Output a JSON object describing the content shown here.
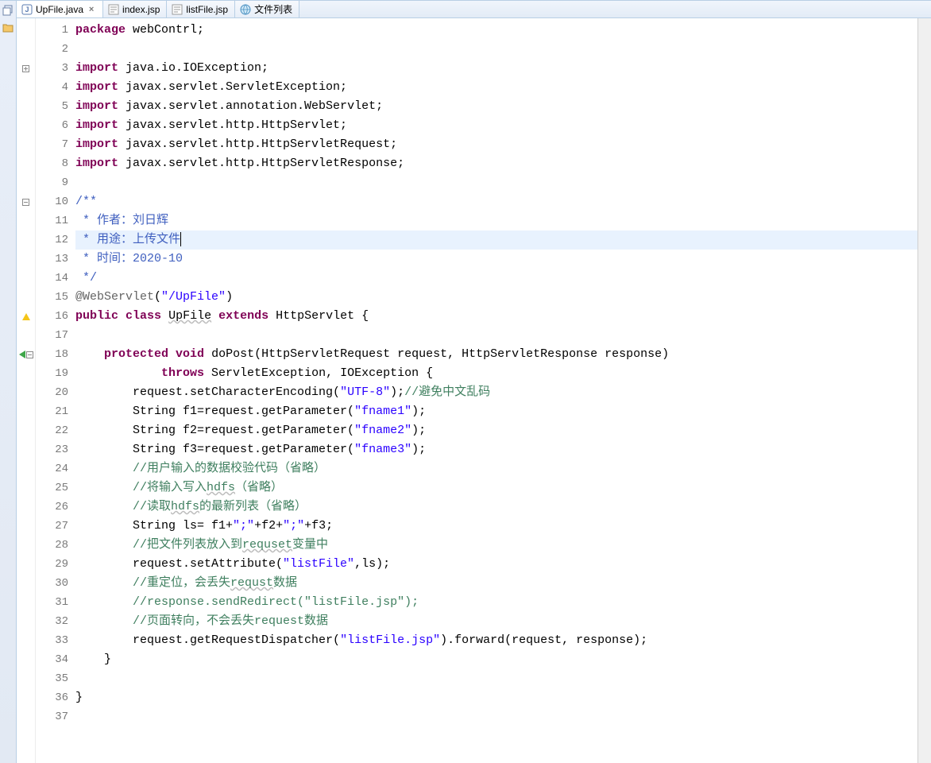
{
  "tabs": [
    {
      "label": "UpFile.java",
      "icon": "java-file-icon",
      "active": true,
      "closeable": true
    },
    {
      "label": "index.jsp",
      "icon": "jsp-file-icon",
      "active": false,
      "closeable": false
    },
    {
      "label": "listFile.jsp",
      "icon": "jsp-file-icon",
      "active": false,
      "closeable": false
    },
    {
      "label": "文件列表",
      "icon": "globe-icon",
      "active": false,
      "closeable": false
    }
  ],
  "left_tools": [
    "restore-icon",
    "folder-icon"
  ],
  "code": {
    "lines": [
      {
        "n": 1,
        "tokens": [
          [
            "kw",
            "package"
          ],
          [
            "",
            " webContrl;"
          ]
        ]
      },
      {
        "n": 2,
        "tokens": []
      },
      {
        "n": 3,
        "marker": "fold-plus",
        "tokens": [
          [
            "kw",
            "import"
          ],
          [
            "",
            " java.io.IOException;"
          ]
        ]
      },
      {
        "n": 4,
        "tokens": [
          [
            "kw",
            "import"
          ],
          [
            "",
            " javax.servlet.ServletException;"
          ]
        ]
      },
      {
        "n": 5,
        "tokens": [
          [
            "kw",
            "import"
          ],
          [
            "",
            " javax.servlet.annotation.WebServlet;"
          ]
        ]
      },
      {
        "n": 6,
        "tokens": [
          [
            "kw",
            "import"
          ],
          [
            "",
            " javax.servlet.http.HttpServlet;"
          ]
        ]
      },
      {
        "n": 7,
        "tokens": [
          [
            "kw",
            "import"
          ],
          [
            "",
            " javax.servlet.http.HttpServletRequest;"
          ]
        ]
      },
      {
        "n": 8,
        "tokens": [
          [
            "kw",
            "import"
          ],
          [
            "",
            " javax.servlet.http.HttpServletResponse;"
          ]
        ]
      },
      {
        "n": 9,
        "tokens": []
      },
      {
        "n": 10,
        "marker": "fold-minus",
        "tokens": [
          [
            "cm-block",
            "/**"
          ]
        ]
      },
      {
        "n": 11,
        "tokens": [
          [
            "cm-block",
            " * 作者：刘日辉"
          ]
        ]
      },
      {
        "n": 12,
        "hl": true,
        "tokens": [
          [
            "cm-block",
            " * 用途：上传文件"
          ],
          [
            "caret",
            ""
          ]
        ]
      },
      {
        "n": 13,
        "tokens": [
          [
            "cm-block",
            " * 时间：2020-10"
          ]
        ]
      },
      {
        "n": 14,
        "tokens": [
          [
            "cm-block",
            " */"
          ]
        ]
      },
      {
        "n": 15,
        "tokens": [
          [
            "ann",
            "@WebServlet"
          ],
          [
            "",
            "("
          ],
          [
            "str",
            "\"/UpFile\""
          ],
          [
            "",
            ")"
          ]
        ]
      },
      {
        "n": 16,
        "marker": "warn",
        "tokens": [
          [
            "kw",
            "public"
          ],
          [
            "",
            " "
          ],
          [
            "kw",
            "class"
          ],
          [
            "",
            " "
          ],
          [
            "underline",
            "UpFile"
          ],
          [
            "",
            " "
          ],
          [
            "kw",
            "extends"
          ],
          [
            "",
            " HttpServlet {"
          ]
        ]
      },
      {
        "n": 17,
        "tokens": []
      },
      {
        "n": 18,
        "marker": "green-fold",
        "tokens": [
          [
            "",
            "    "
          ],
          [
            "kw",
            "protected"
          ],
          [
            "",
            " "
          ],
          [
            "kw",
            "void"
          ],
          [
            "",
            " doPost(HttpServletRequest request, HttpServletResponse response)"
          ]
        ]
      },
      {
        "n": 19,
        "tokens": [
          [
            "",
            "            "
          ],
          [
            "kw",
            "throws"
          ],
          [
            "",
            " ServletException, IOException {"
          ]
        ]
      },
      {
        "n": 20,
        "tokens": [
          [
            "",
            "        request.setCharacterEncoding("
          ],
          [
            "str",
            "\"UTF-8\""
          ],
          [
            "",
            ");"
          ],
          [
            "cm-line",
            "//避免中文乱码"
          ]
        ]
      },
      {
        "n": 21,
        "tokens": [
          [
            "",
            "        String f1=request.getParameter("
          ],
          [
            "str",
            "\"fname1\""
          ],
          [
            "",
            ");"
          ]
        ]
      },
      {
        "n": 22,
        "tokens": [
          [
            "",
            "        String f2=request.getParameter("
          ],
          [
            "str",
            "\"fname2\""
          ],
          [
            "",
            ");"
          ]
        ]
      },
      {
        "n": 23,
        "tokens": [
          [
            "",
            "        String f3=request.getParameter("
          ],
          [
            "str",
            "\"fname3\""
          ],
          [
            "",
            ");"
          ]
        ]
      },
      {
        "n": 24,
        "tokens": [
          [
            "",
            "        "
          ],
          [
            "cm-line",
            "//用户输入的数据校验代码（省略）"
          ]
        ]
      },
      {
        "n": 25,
        "tokens": [
          [
            "",
            "        "
          ],
          [
            "cm-line",
            "//将输入写入"
          ],
          [
            "cm-line underline",
            "hdfs"
          ],
          [
            "cm-line",
            "（省略）"
          ]
        ]
      },
      {
        "n": 26,
        "tokens": [
          [
            "",
            "        "
          ],
          [
            "cm-line",
            "//读取"
          ],
          [
            "cm-line underline",
            "hdfs"
          ],
          [
            "cm-line",
            "的最新列表（省略）"
          ]
        ]
      },
      {
        "n": 27,
        "tokens": [
          [
            "",
            "        String ls= f1+"
          ],
          [
            "str",
            "\";\""
          ],
          [
            "",
            "+f2+"
          ],
          [
            "str",
            "\";\""
          ],
          [
            "",
            "+f3;"
          ]
        ]
      },
      {
        "n": 28,
        "tokens": [
          [
            "",
            "        "
          ],
          [
            "cm-line",
            "//把文件列表放入到"
          ],
          [
            "cm-line underline",
            "requset"
          ],
          [
            "cm-line",
            "变量中"
          ]
        ]
      },
      {
        "n": 29,
        "tokens": [
          [
            "",
            "        request.setAttribute("
          ],
          [
            "str",
            "\"listFile\""
          ],
          [
            "",
            ",ls);"
          ]
        ]
      },
      {
        "n": 30,
        "tokens": [
          [
            "",
            "        "
          ],
          [
            "cm-line",
            "//重定位，会丢失"
          ],
          [
            "cm-line underline",
            "requst"
          ],
          [
            "cm-line",
            "数据"
          ]
        ]
      },
      {
        "n": 31,
        "tokens": [
          [
            "",
            "        "
          ],
          [
            "cm-line",
            "//response.sendRedirect(\"listFile.jsp\");"
          ]
        ]
      },
      {
        "n": 32,
        "tokens": [
          [
            "",
            "        "
          ],
          [
            "cm-line",
            "//页面转向，不会丢失request数据"
          ]
        ]
      },
      {
        "n": 33,
        "tokens": [
          [
            "",
            "        request.getRequestDispatcher("
          ],
          [
            "str",
            "\"listFile.jsp\""
          ],
          [
            "",
            ").forward(request, response);"
          ]
        ]
      },
      {
        "n": 34,
        "tokens": [
          [
            "",
            "    }"
          ]
        ]
      },
      {
        "n": 35,
        "tokens": []
      },
      {
        "n": 36,
        "tokens": [
          [
            "",
            "}"
          ]
        ]
      },
      {
        "n": 37,
        "tokens": []
      }
    ]
  }
}
